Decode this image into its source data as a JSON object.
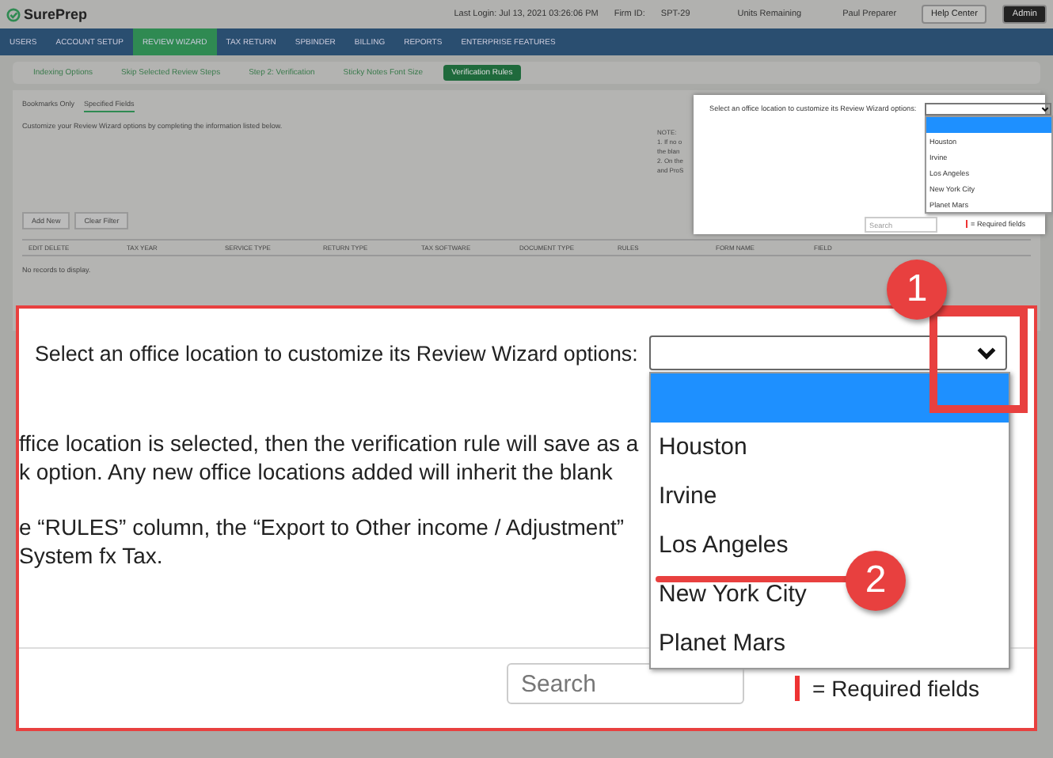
{
  "header": {
    "logo": "SurePrep",
    "last_login": "Last Login: Jul 13, 2021 03:26:06 PM",
    "firm_label": "Firm ID:",
    "firm_id": "SPT-29",
    "units": "Units Remaining",
    "user": "Paul Preparer",
    "help": "Help Center",
    "role": "Admin"
  },
  "nav": [
    {
      "label": "USERS",
      "selected": false
    },
    {
      "label": "ACCOUNT SETUP",
      "selected": false
    },
    {
      "label": "REVIEW WIZARD",
      "selected": true
    },
    {
      "label": "TAX RETURN",
      "selected": false
    },
    {
      "label": "SPBINDER",
      "selected": false
    },
    {
      "label": "BILLING",
      "selected": false
    },
    {
      "label": "REPORTS",
      "selected": false
    },
    {
      "label": "ENTERPRISE FEATURES",
      "selected": false
    }
  ],
  "subtabs": [
    {
      "label": "Indexing Options",
      "selected": false
    },
    {
      "label": "Skip Selected Review Steps",
      "selected": false
    },
    {
      "label": "Step 2: Verification",
      "selected": false
    },
    {
      "label": "Sticky Notes Font Size",
      "selected": false
    },
    {
      "label": "Verification Rules",
      "selected": true
    }
  ],
  "panel": {
    "tabs": [
      {
        "label": "Bookmarks Only",
        "selected": false
      },
      {
        "label": "Specified Fields",
        "selected": true
      }
    ],
    "description": "Customize your Review Wizard options by completing the information listed below.",
    "note": [
      "NOTE:",
      "1. If no o",
      "the blan",
      "2. On the",
      "and ProS"
    ],
    "add": "Add New",
    "clear": "Clear Filter",
    "columns": [
      "EDIT DELETE",
      "TAX YEAR",
      "SERVICE TYPE",
      "RETURN TYPE",
      "TAX SOFTWARE",
      "DOCUMENT TYPE",
      "RULES",
      "FORM NAME",
      "FIELD"
    ],
    "empty": "No records to display."
  },
  "inset": {
    "prompt": "Select an office location to customize its Review Wizard options:",
    "options": [
      {
        "selected": true
      },
      {
        "label": "Houston",
        "selected": false
      },
      {
        "label": "Irvine",
        "selected": false
      },
      {
        "label": "Los Angeles",
        "selected": false
      },
      {
        "label": "New York City",
        "selected": false
      },
      {
        "label": "Planet Mars",
        "selected": false
      }
    ],
    "search_placeholder": "Search",
    "required": "= Required fields"
  },
  "callout": {
    "prompt": "Select an office location to customize its Review Wizard options:",
    "note_lines": [
      "ffice location is selected, then the verification rule will save as a",
      "k option. Any new office locations added will inherit the blank",
      "e “RULES” column, the “Export to Other income / Adjustment”",
      "System fx Tax."
    ],
    "options": [
      {
        "selected": true
      },
      {
        "label": "Houston",
        "selected": false
      },
      {
        "label": "Irvine",
        "selected": false
      },
      {
        "label": "Los Angeles",
        "selected": false
      },
      {
        "label": "New York City",
        "selected": false
      },
      {
        "label": "Planet Mars",
        "selected": false
      }
    ],
    "search_placeholder": "Search",
    "required": "= Required fields",
    "markers": [
      "1",
      "2"
    ]
  }
}
